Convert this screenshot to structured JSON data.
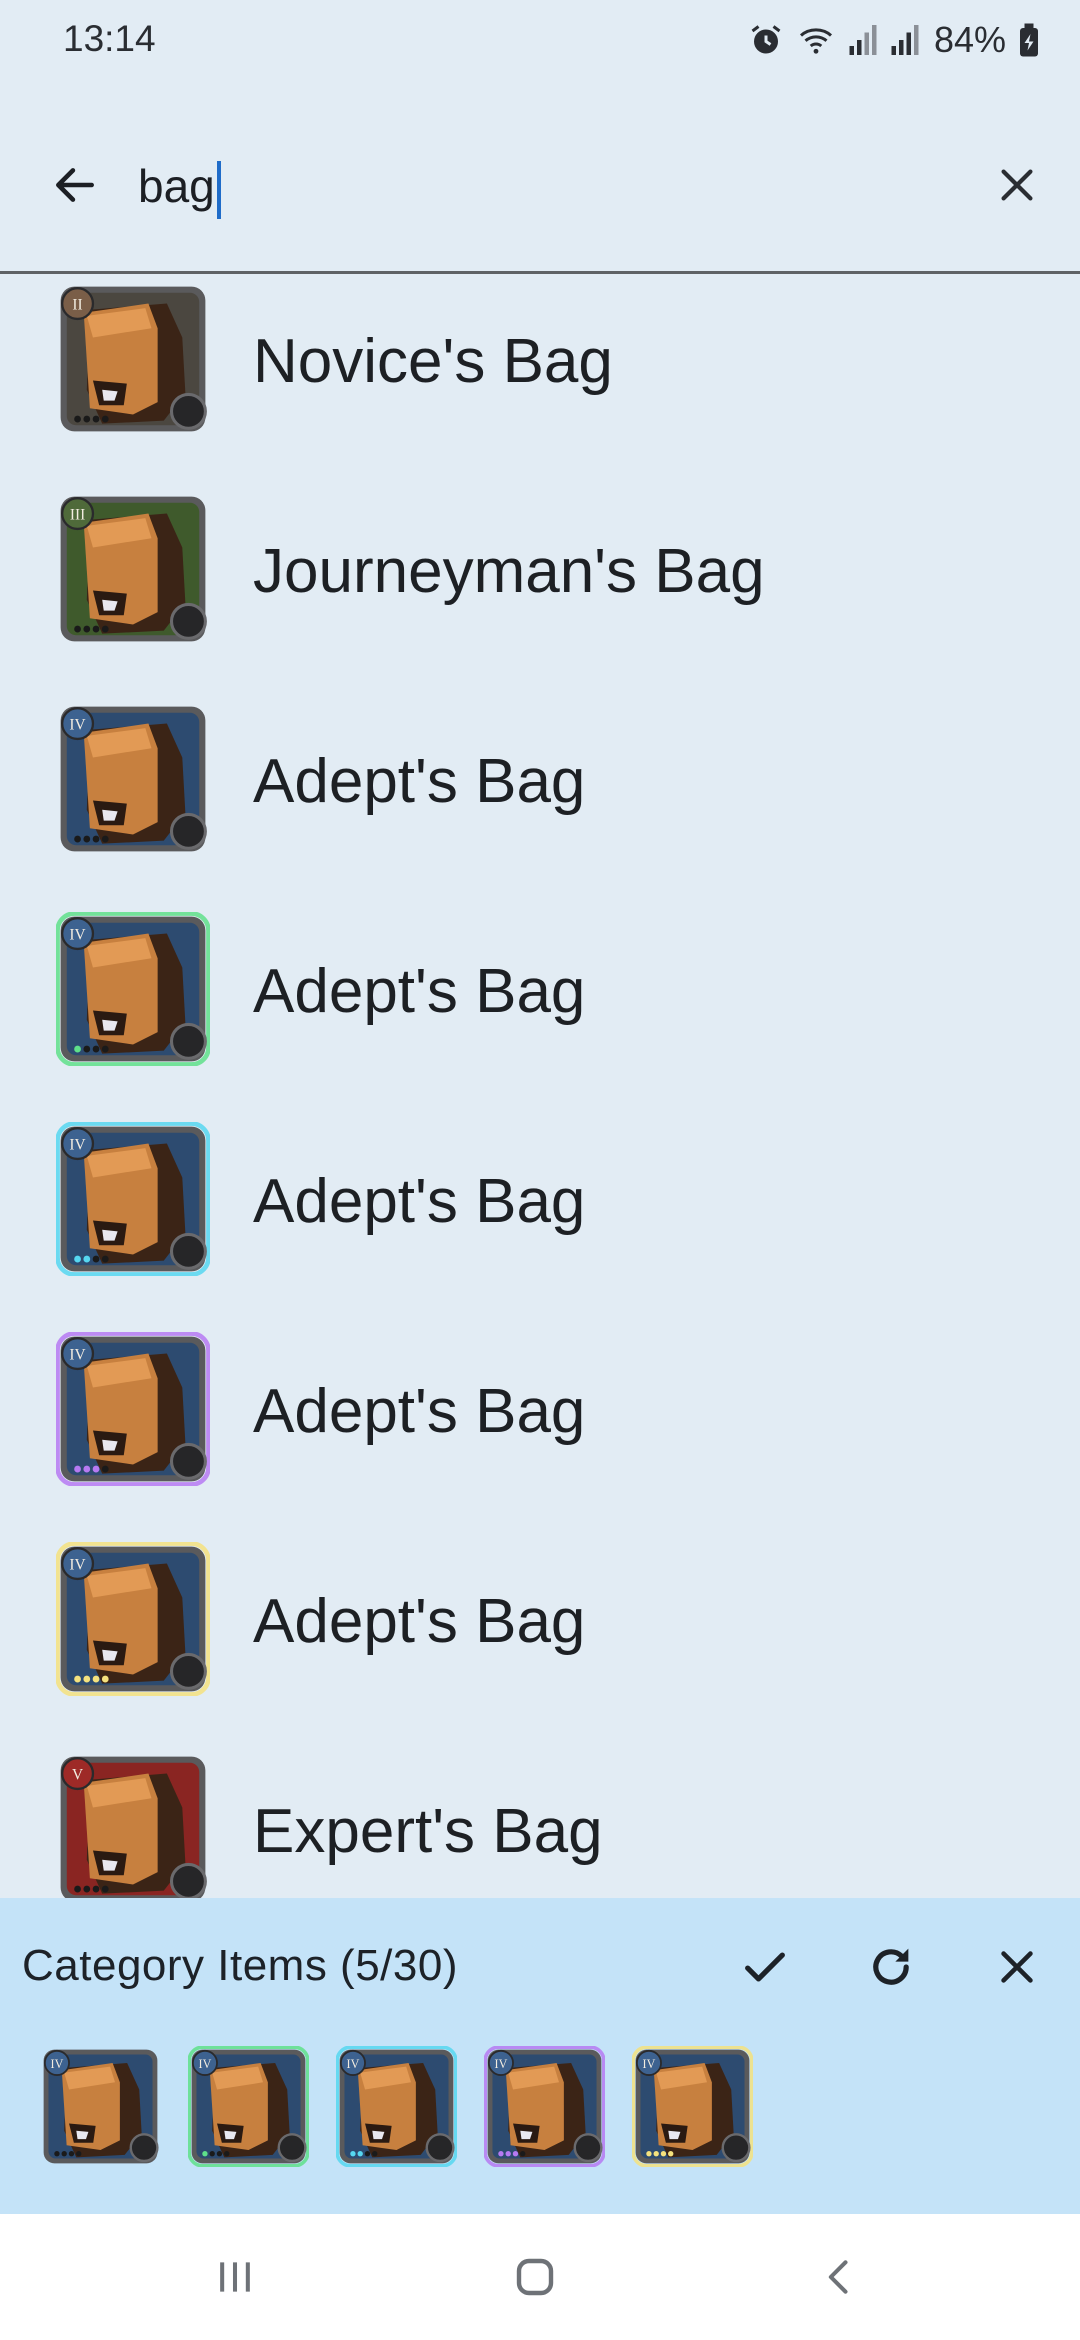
{
  "status": {
    "time": "13:14",
    "battery": "84%",
    "icons": [
      "alarm-icon",
      "wifi-icon",
      "signal-icon",
      "signal-icon",
      "battery-icon"
    ]
  },
  "search": {
    "value": "bag",
    "back_icon": "arrow-left-icon",
    "clear_icon": "close-icon"
  },
  "results": [
    {
      "label": "Novice's Bag",
      "tier": "II",
      "rarity": "normal",
      "tier_color": "#7a5e48",
      "bg": "#4b4740",
      "frame": "#4a4b4d"
    },
    {
      "label": "Journeyman's Bag",
      "tier": "III",
      "rarity": "normal",
      "tier_color": "#4f6a3a",
      "bg": "#3f5a2c",
      "frame": "#4a4b4d"
    },
    {
      "label": "Adept's Bag",
      "tier": "IV",
      "rarity": "normal",
      "tier_color": "#3d6290",
      "bg": "#2d4b70",
      "frame": "#4a4b4d"
    },
    {
      "label": "Adept's Bag",
      "tier": "IV",
      "rarity": "uncommon",
      "tier_color": "#3d6290",
      "bg": "#2d4b70",
      "frame": "#5fe08a"
    },
    {
      "label": "Adept's Bag",
      "tier": "IV",
      "rarity": "rare",
      "tier_color": "#3d6290",
      "bg": "#2d4b70",
      "frame": "#56d7f0"
    },
    {
      "label": "Adept's Bag",
      "tier": "IV",
      "rarity": "exceptional",
      "tier_color": "#3d6290",
      "bg": "#2d4b70",
      "frame": "#b67af2"
    },
    {
      "label": "Adept's Bag",
      "tier": "IV",
      "rarity": "masterpiece",
      "tier_color": "#3d6290",
      "bg": "#2d4b70",
      "frame": "#f5e27e"
    },
    {
      "label": "Expert's Bag",
      "tier": "V",
      "rarity": "normal",
      "tier_color": "#9e2a27",
      "bg": "#8a2522",
      "frame": "#4a4b4d"
    }
  ],
  "category": {
    "title": "Category Items (5/30)",
    "confirm_icon": "check-icon",
    "refresh_icon": "refresh-icon",
    "close_icon": "close-icon",
    "items": [
      {
        "tier": "IV",
        "frame": "#4a4b4d"
      },
      {
        "tier": "IV",
        "frame": "#5fe08a"
      },
      {
        "tier": "IV",
        "frame": "#56d7f0"
      },
      {
        "tier": "IV",
        "frame": "#b67af2"
      },
      {
        "tier": "IV",
        "frame": "#f5e27e"
      }
    ]
  },
  "nav": {
    "recents_icon": "recents-icon",
    "home_icon": "home-icon",
    "back_icon": "back-icon"
  }
}
